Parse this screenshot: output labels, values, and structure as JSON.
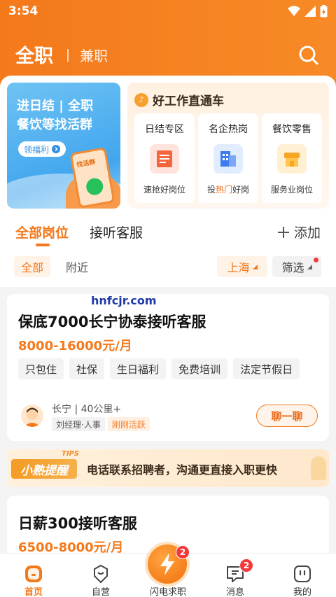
{
  "status": {
    "time": "3:54"
  },
  "header": {
    "tab_fulltime": "全职",
    "tab_parttime": "兼职"
  },
  "banner": {
    "line1": "进日结 | 全职",
    "line2": "餐饮等找活群",
    "button": "领福利",
    "phone_label": "找活群"
  },
  "hot": {
    "title": "好工作直通车",
    "cards": [
      {
        "title": "日结专区",
        "sub_a": "速抢好岗位",
        "sub_hl": "",
        "sub_b": ""
      },
      {
        "title": "名企热岗",
        "sub_a": "投",
        "sub_hl": "热门",
        "sub_b": "好岗"
      },
      {
        "title": "餐饮零售",
        "sub_a": "服务业岗位",
        "sub_hl": "",
        "sub_b": ""
      }
    ]
  },
  "tabs": {
    "all_jobs": "全部岗位",
    "listening": "接听客服",
    "add": "添加"
  },
  "filters": {
    "all": "全部",
    "nearby": "附近",
    "city": "上海",
    "filter": "筛选"
  },
  "watermark": "hnfcjr.com",
  "job1": {
    "title": "保底7000长宁协泰接听客服",
    "salary": "8000-16000元/月",
    "tags": [
      "只包住",
      "社保",
      "生日福利",
      "免费培训",
      "法定节假日"
    ],
    "location": "长宁 | 40公里+",
    "recruiter": "刘经理·人事",
    "active": "刚刚活跃",
    "chat": "聊一聊"
  },
  "tips": {
    "badge": "小熟提醒",
    "badge_sup": "TIPS",
    "text": "电话联系招聘者，沟通更直接入职更快"
  },
  "job2": {
    "title": "日薪300接听客服",
    "salary": "6500-8000元/月"
  },
  "tabbar": {
    "home": "首页",
    "self": "自营",
    "flash": "闪电求职",
    "flash_badge": "2",
    "messages": "消息",
    "messages_badge": "2",
    "mine": "我的"
  },
  "colors": {
    "accent": "#f4791b",
    "badge": "#f23a3a"
  }
}
